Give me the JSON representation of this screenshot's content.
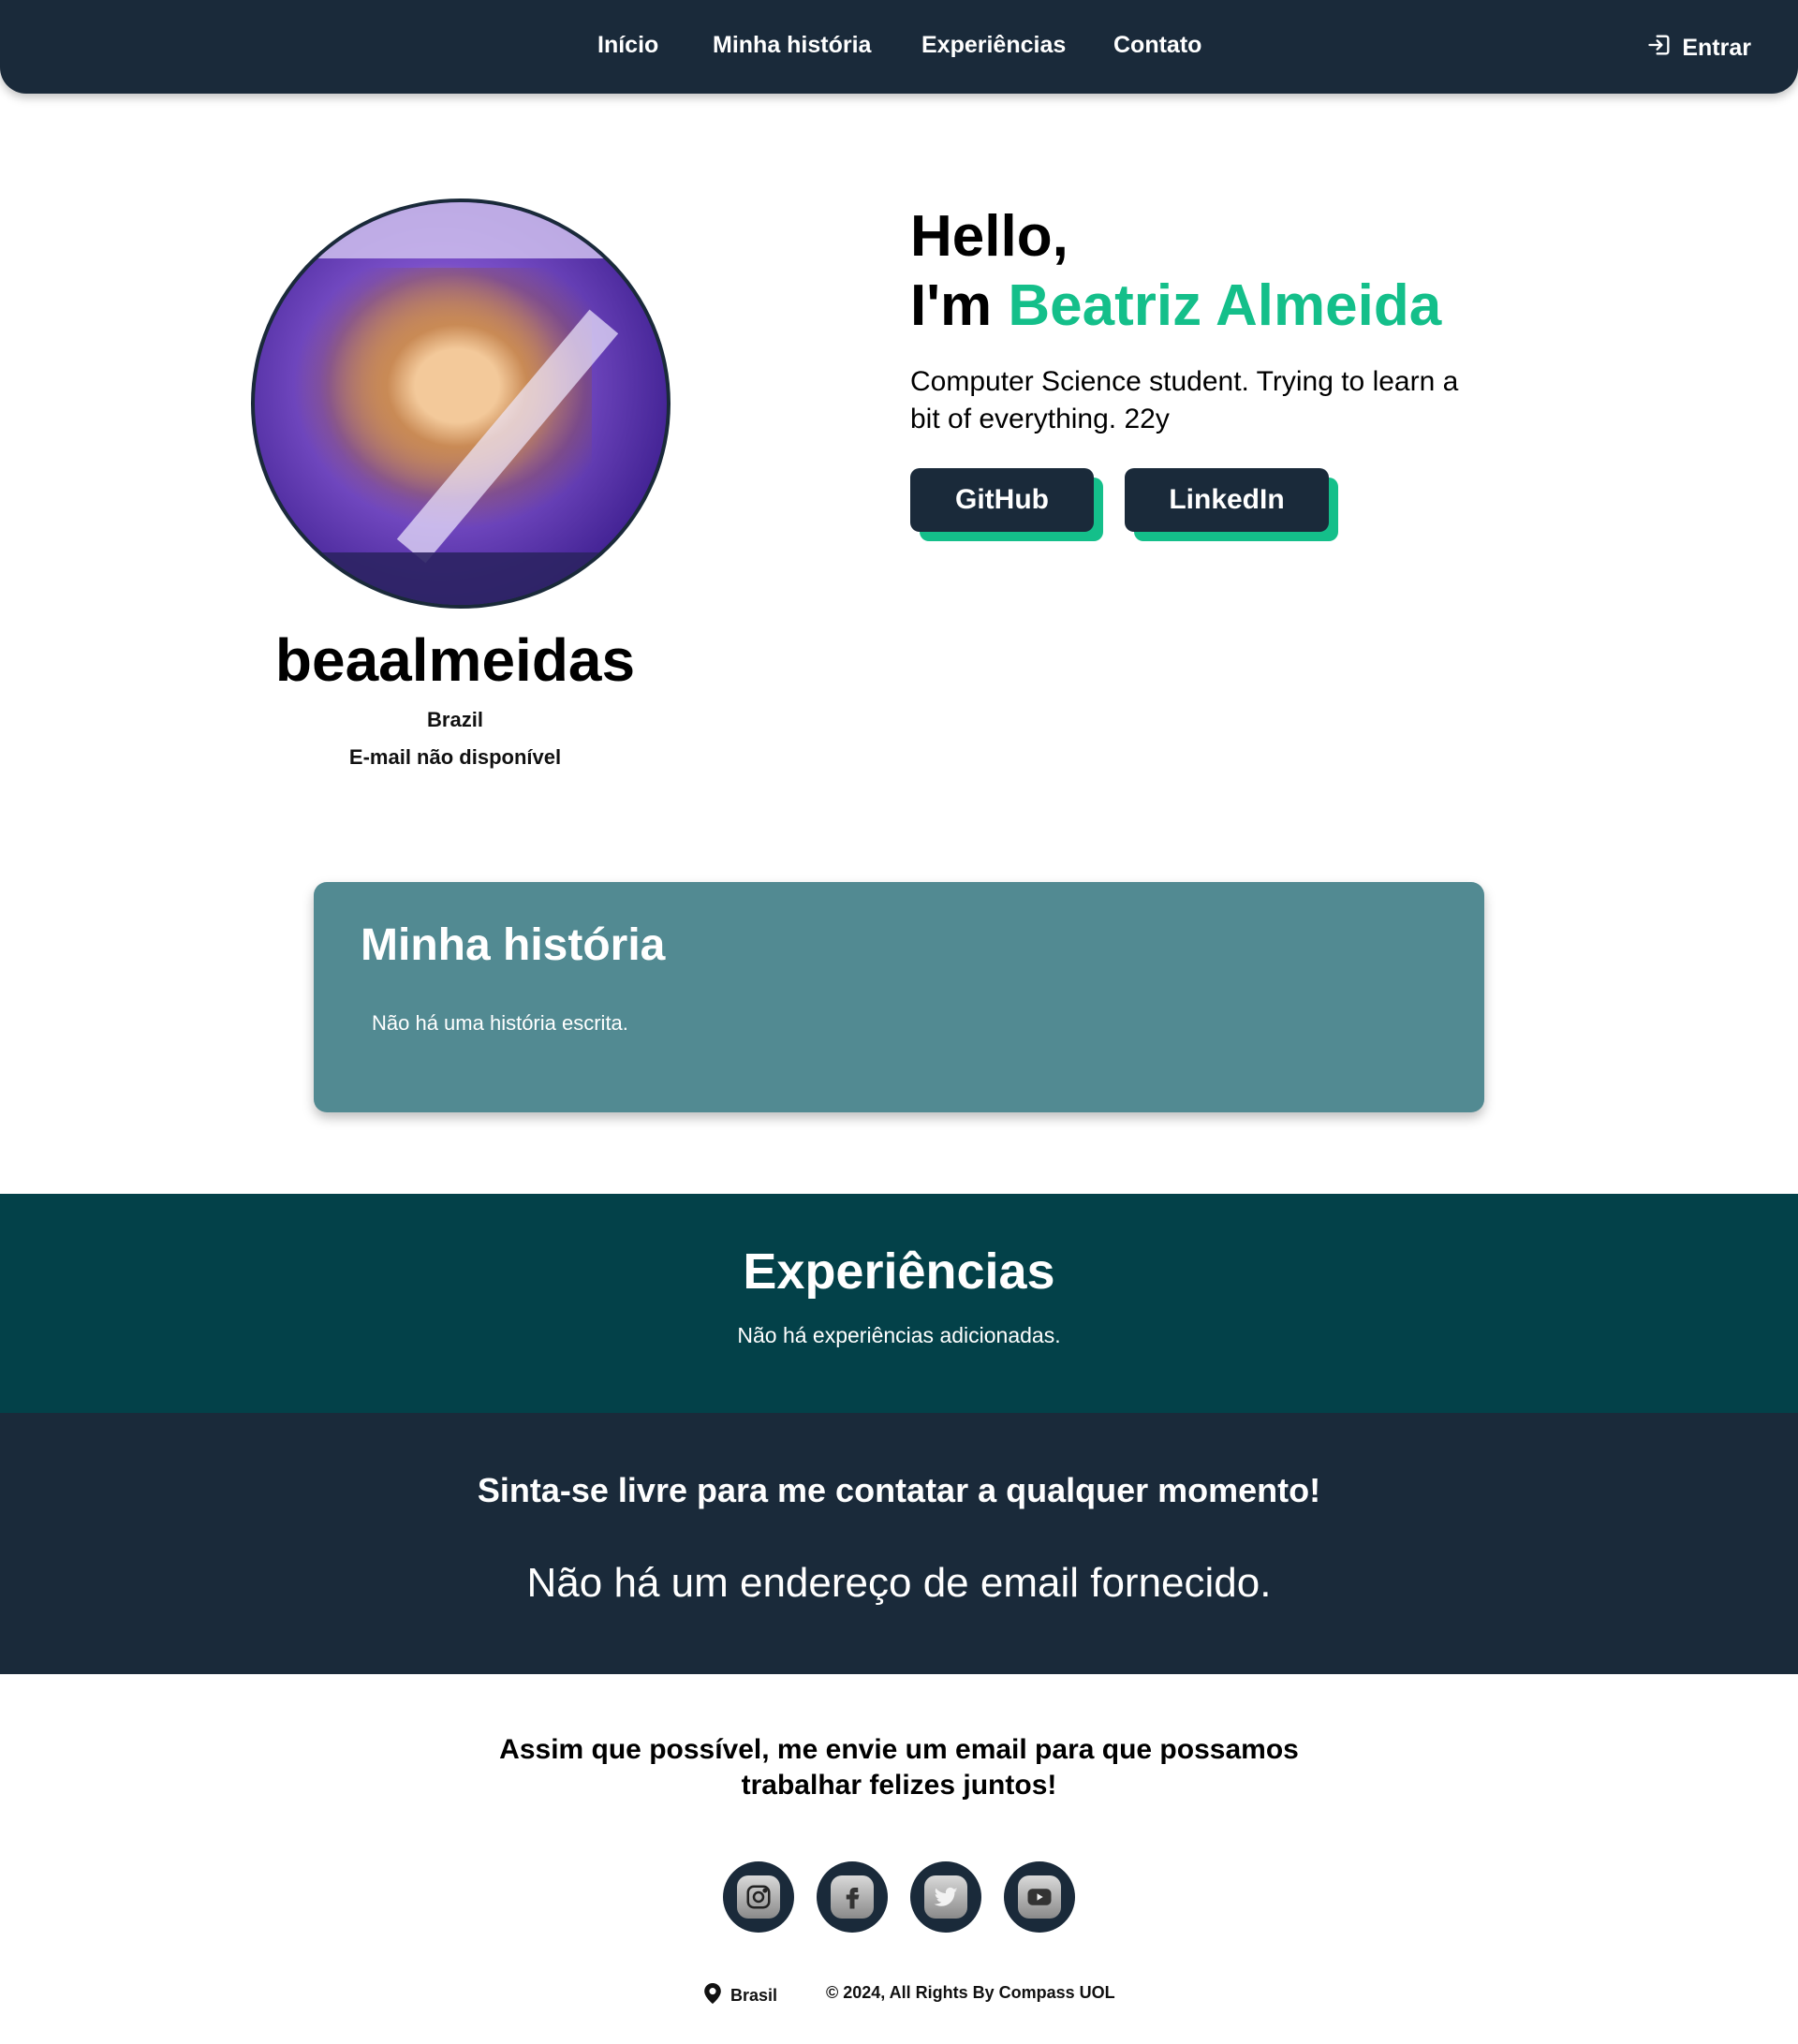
{
  "header": {
    "nav": [
      {
        "label": "Início"
      },
      {
        "label": "Minha história"
      },
      {
        "label": "Experiências"
      },
      {
        "label": "Contato"
      }
    ],
    "login_label": "Entrar",
    "login_icon": "login-icon"
  },
  "profile": {
    "username": "beaalmeidas",
    "location": "Brazil",
    "email_status": "E-mail não disponível",
    "greeting_line1": "Hello,",
    "greeting_prefix": "I'm",
    "full_name": "Beatriz Almeida",
    "bio": "Computer Science student. Trying to learn a bit of everything. 22y",
    "buttons": [
      {
        "label": "GitHub"
      },
      {
        "label": "LinkedIn"
      }
    ],
    "accent_color": "#14bf8a"
  },
  "story": {
    "title": "Minha história",
    "text": "Não há uma história escrita."
  },
  "experiences": {
    "title": "Experiências",
    "text": "Não há experiências adicionadas."
  },
  "contact": {
    "title": "Sinta-se livre para me contatar a qualquer momento!",
    "email_text": "Não há um endereço de email fornecido."
  },
  "footer": {
    "message": "Assim que possível, me envie um email para que possamos trabalhar felizes juntos!",
    "socials": [
      "instagram-icon",
      "facebook-icon",
      "twitter-icon",
      "youtube-icon"
    ],
    "location": "Brasil",
    "copyright": "© 2024, All Rights By Compass UOL"
  },
  "colors": {
    "navy": "#1a2a3a",
    "teal_card": "#528a92",
    "dark_teal": "#034149"
  }
}
